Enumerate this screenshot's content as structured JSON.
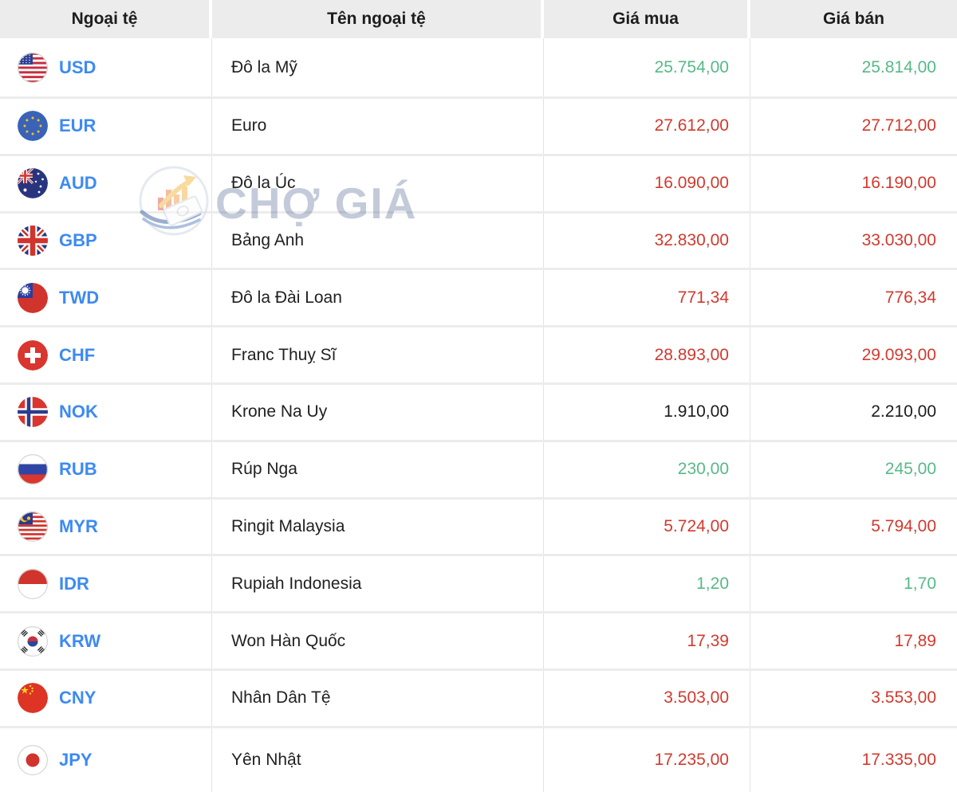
{
  "watermark": {
    "text": "CHỢ GIÁ"
  },
  "colors": {
    "up": "#57b987",
    "down": "#d2392e",
    "neutral": "#1c1c1c",
    "code_blue": "#3d8af2",
    "header_bg": "#ececec"
  },
  "table": {
    "columns": [
      {
        "key": "code",
        "label": "Ngoại tệ"
      },
      {
        "key": "name",
        "label": "Tên ngoại tệ"
      },
      {
        "key": "buy",
        "label": "Giá mua"
      },
      {
        "key": "sell",
        "label": "Giá bán"
      }
    ],
    "rows": [
      {
        "flag": "us",
        "code": "USD",
        "name": "Đô la Mỹ",
        "buy": "25.754,00",
        "sell": "25.814,00",
        "trend": "up"
      },
      {
        "flag": "eu",
        "code": "EUR",
        "name": "Euro",
        "buy": "27.612,00",
        "sell": "27.712,00",
        "trend": "down"
      },
      {
        "flag": "au",
        "code": "AUD",
        "name": "Đô la Úc",
        "buy": "16.090,00",
        "sell": "16.190,00",
        "trend": "down"
      },
      {
        "flag": "gb",
        "code": "GBP",
        "name": "Bảng Anh",
        "buy": "32.830,00",
        "sell": "33.030,00",
        "trend": "down"
      },
      {
        "flag": "tw",
        "code": "TWD",
        "name": "Đô la Đài Loan",
        "buy": "771,34",
        "sell": "776,34",
        "trend": "down"
      },
      {
        "flag": "ch",
        "code": "CHF",
        "name": "Franc Thuỵ Sĩ",
        "buy": "28.893,00",
        "sell": "29.093,00",
        "trend": "down"
      },
      {
        "flag": "no",
        "code": "NOK",
        "name": "Krone Na Uy",
        "buy": "1.910,00",
        "sell": "2.210,00",
        "trend": "neutral"
      },
      {
        "flag": "ru",
        "code": "RUB",
        "name": "Rúp Nga",
        "buy": "230,00",
        "sell": "245,00",
        "trend": "up"
      },
      {
        "flag": "my",
        "code": "MYR",
        "name": "Ringit Malaysia",
        "buy": "5.724,00",
        "sell": "5.794,00",
        "trend": "down"
      },
      {
        "flag": "id",
        "code": "IDR",
        "name": "Rupiah Indonesia",
        "buy": "1,20",
        "sell": "1,70",
        "trend": "up"
      },
      {
        "flag": "kr",
        "code": "KRW",
        "name": "Won Hàn Quốc",
        "buy": "17,39",
        "sell": "17,89",
        "trend": "down"
      },
      {
        "flag": "cn",
        "code": "CNY",
        "name": "Nhân Dân Tệ",
        "buy": "3.503,00",
        "sell": "3.553,00",
        "trend": "down"
      },
      {
        "flag": "jp",
        "code": "JPY",
        "name": "Yên Nhật",
        "buy": "17.235,00",
        "sell": "17.335,00",
        "trend": "down"
      }
    ]
  }
}
